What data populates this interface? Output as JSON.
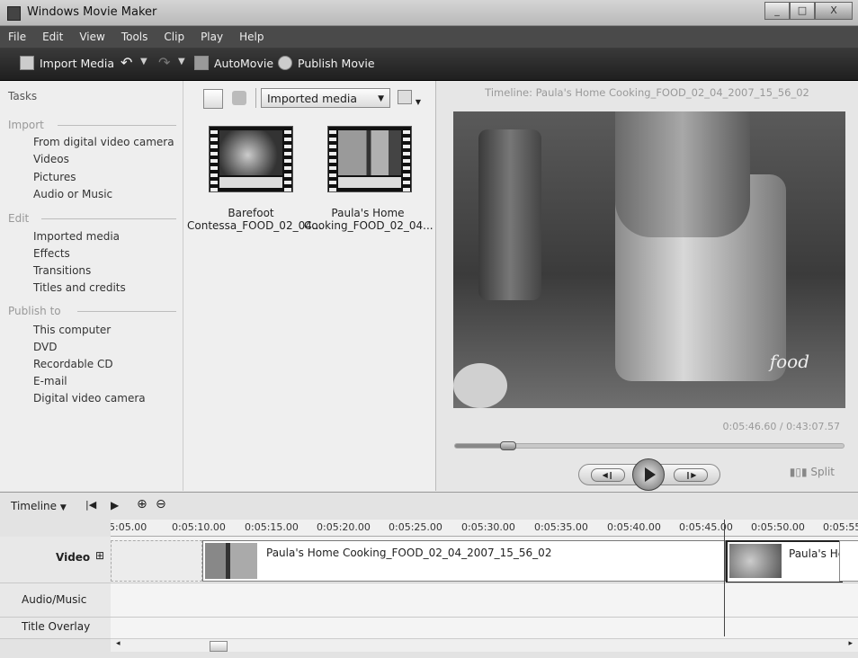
{
  "window": {
    "title": "Windows Movie Maker",
    "controls": [
      "_",
      "□",
      "X"
    ]
  },
  "menu": [
    "File",
    "Edit",
    "View",
    "Tools",
    "Clip",
    "Play",
    "Help"
  ],
  "toolbar": {
    "import_media": "Import Media",
    "automovie": "AutoMovie",
    "publish_movie": "Publish Movie"
  },
  "tasks": {
    "title": "Tasks",
    "sections": [
      {
        "label": "Import",
        "items": [
          "From digital video camera",
          "Videos",
          "Pictures",
          "Audio or Music"
        ]
      },
      {
        "label": "Edit",
        "items": [
          "Imported media",
          "Effects",
          "Transitions",
          "Titles and credits"
        ]
      },
      {
        "label": "Publish to",
        "items": [
          "This computer",
          "DVD",
          "Recordable CD",
          "E-mail",
          "Digital video camera"
        ]
      }
    ]
  },
  "collection": {
    "selected": "Imported media",
    "items": [
      {
        "line1": "Barefoot",
        "line2": "Contessa_FOOD_02_04..."
      },
      {
        "line1": "Paula's Home",
        "line2": "Cooking_FOOD_02_04..."
      }
    ]
  },
  "preview": {
    "title": "Timeline: Paula's Home Cooking_FOOD_02_04_2007_15_56_02",
    "watermark": "food",
    "time": "0:05:46.60 / 0:43:07.57",
    "progress_fraction": 0.134,
    "split_label": "Split"
  },
  "timeline": {
    "label": "Timeline",
    "ruler": [
      "5:05.00",
      "0:05:10.00",
      "0:05:15.00",
      "0:05:20.00",
      "0:05:25.00",
      "0:05:30.00",
      "0:05:35.00",
      "0:05:40.00",
      "0:05:45.00",
      "0:05:50.00",
      "0:05:55"
    ],
    "tracks": {
      "video": "Video",
      "video_expand": "⊞",
      "audio": "Audio/Music",
      "title": "Title Overlay"
    },
    "clips": [
      {
        "label": "Paula's Home Cooking_FOOD_02_04_2007_15_56_02"
      },
      {
        "label": "Paula's Hc"
      }
    ]
  }
}
